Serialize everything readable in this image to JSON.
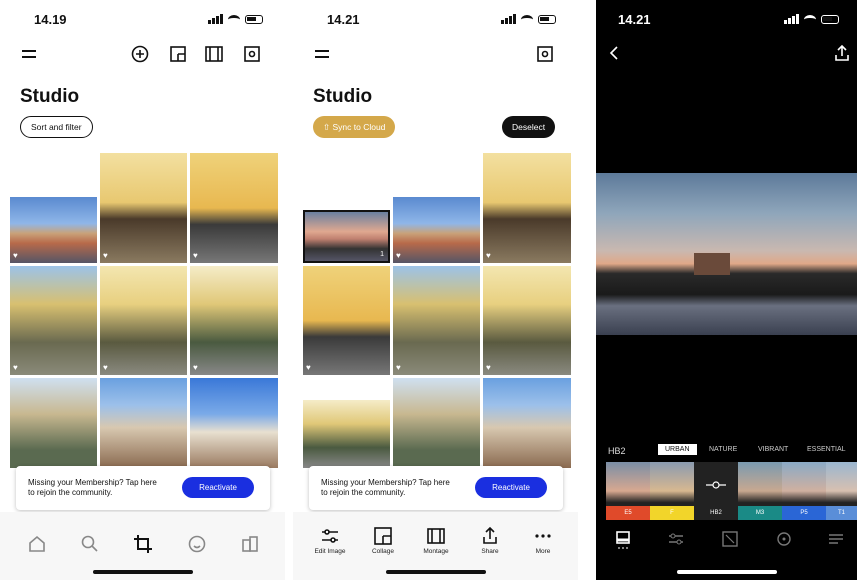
{
  "screens": {
    "studio": {
      "time": "14.19",
      "title": "Studio",
      "sort_button": "Sort and filter",
      "banner_text": "Missing your Membership? Tap here to rejoin the community.",
      "banner_button": "Reactivate",
      "tabs": [
        "home-icon",
        "search-icon",
        "crop-icon",
        "smiley-icon",
        "profile-icon"
      ]
    },
    "selection": {
      "time": "14.21",
      "title": "Studio",
      "sync_button": "⇧ Sync to Cloud",
      "deselect_button": "Deselect",
      "banner_text": "Missing your Membership? Tap here to rejoin the community.",
      "banner_button": "Reactivate",
      "selected_count": "1",
      "actions": [
        "Edit Image",
        "Collage",
        "Montage",
        "Share",
        "More"
      ]
    },
    "editor": {
      "time": "14.21",
      "preset_label": "HB2",
      "categories": [
        "URBAN",
        "NATURE",
        "VIBRANT",
        "ESSENTIAL"
      ],
      "active_category": "URBAN",
      "presets": [
        "E5",
        "F",
        "HB2",
        "M3",
        "P5",
        "T1"
      ],
      "preset_colors": [
        "#e04a2a",
        "#f2d52a",
        "#222222",
        "#1a8a86",
        "#2a66d6",
        "#5a8ed8"
      ]
    }
  },
  "colors": {
    "accent": "#1a2fe0",
    "sync": "#d4a84a"
  }
}
